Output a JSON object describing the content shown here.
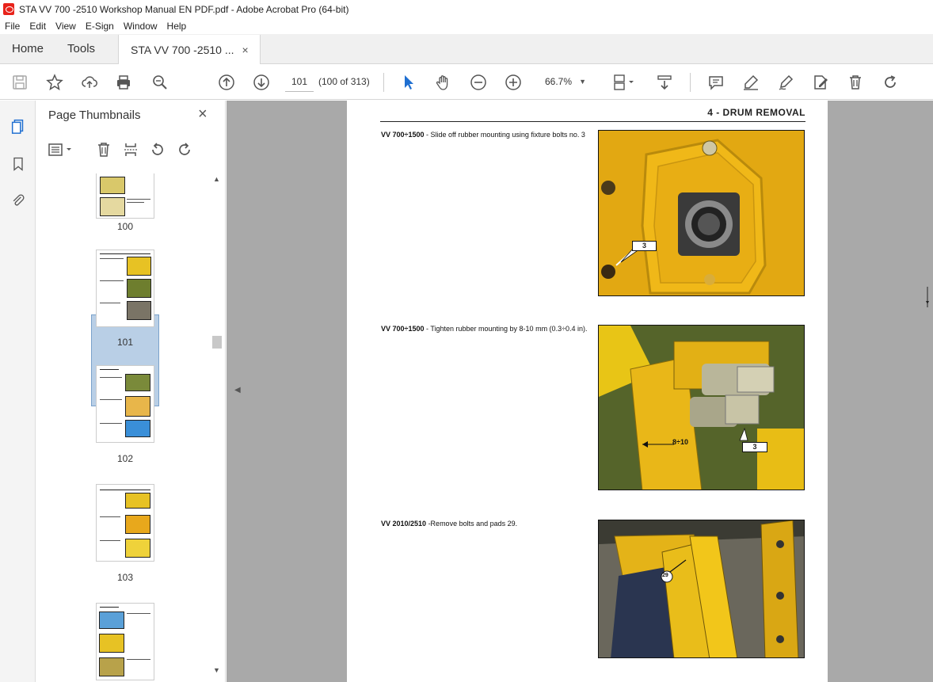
{
  "window": {
    "title": "STA VV 700 -2510 Workshop Manual EN PDF.pdf - Adobe Acrobat Pro (64-bit)"
  },
  "menu": [
    "File",
    "Edit",
    "View",
    "E-Sign",
    "Window",
    "Help"
  ],
  "tabs": {
    "home": "Home",
    "tools": "Tools",
    "document": "STA VV 700 -2510 ...",
    "close": "×"
  },
  "toolbar": {
    "page_number": "101",
    "page_count": "(100 of 313)",
    "zoom": "66.7%"
  },
  "panel": {
    "title": "Page Thumbnails",
    "close": "×",
    "thumb_labels": [
      "100",
      "101",
      "102",
      "103"
    ]
  },
  "page": {
    "header": "4 - DRUM REMOVAL",
    "steps": [
      {
        "model": "VV 700÷1500",
        "text": " - Slide off rubber mounting using fixture bolts no. 3"
      },
      {
        "model": "VV 700÷1500",
        "text": " - Tighten rubber mounting by 8-10 mm (0.3÷0.4 in)."
      },
      {
        "model": "VV 2010/2510",
        "text": " -Remove bolts and pads 29."
      }
    ],
    "callouts": {
      "p1": "3",
      "p2_gap": "8÷10",
      "p2": "3",
      "p3": "29"
    }
  }
}
